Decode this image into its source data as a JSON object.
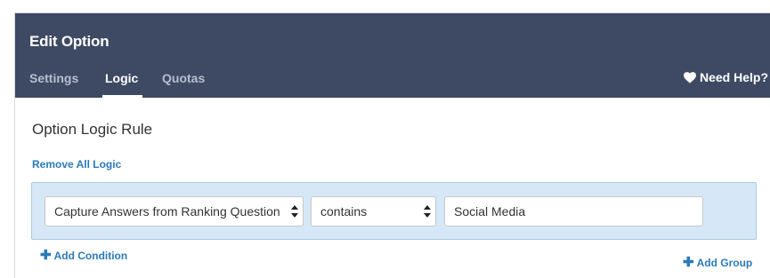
{
  "window": {
    "title": "Edit Option"
  },
  "tabs": [
    {
      "label": "Settings",
      "active": false
    },
    {
      "label": "Logic",
      "active": true
    },
    {
      "label": "Quotas",
      "active": false
    }
  ],
  "help": {
    "label": "Need Help?",
    "icon": "heart-icon"
  },
  "section": {
    "title": "Option Logic Rule"
  },
  "actions": {
    "remove_all": "Remove All Logic",
    "add_condition": "Add Condition",
    "add_group": "Add Group"
  },
  "condition": {
    "question": "Capture Answers from Ranking Question",
    "operator": "contains",
    "value": "Social Media"
  },
  "colors": {
    "header_bg": "#3e4a64",
    "accent": "#2a7ab8",
    "logic_box_bg": "#d6e8f7"
  }
}
